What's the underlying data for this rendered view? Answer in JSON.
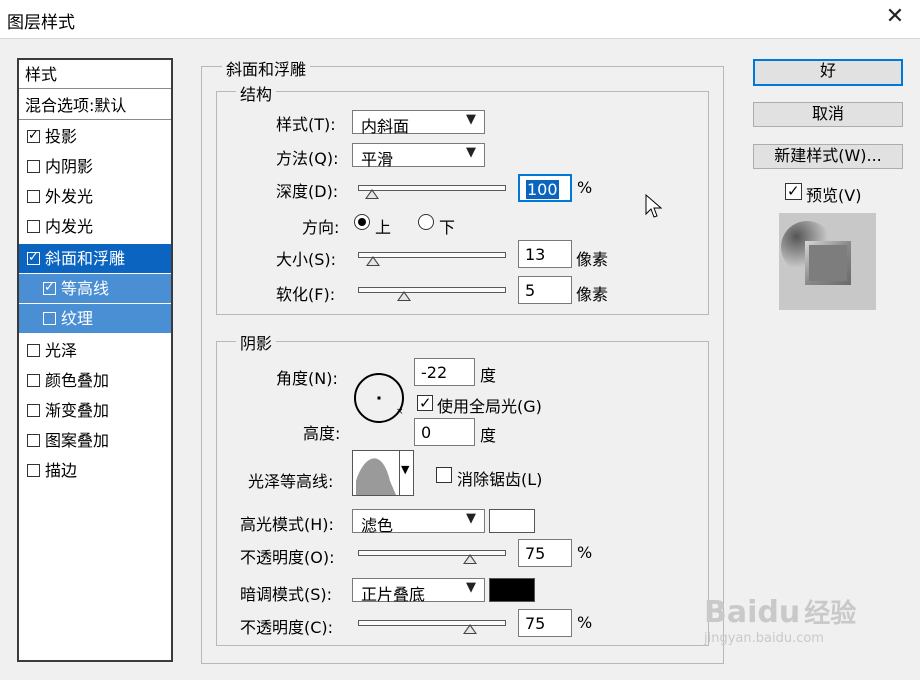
{
  "window": {
    "title": "图层样式",
    "close_icon": "close-icon"
  },
  "sidebar": {
    "header": "样式",
    "blend": "混合选项:默认",
    "items": [
      {
        "label": "投影",
        "checked": true
      },
      {
        "label": "内阴影",
        "checked": false
      },
      {
        "label": "外发光",
        "checked": false
      },
      {
        "label": "内发光",
        "checked": false
      },
      {
        "label": "斜面和浮雕",
        "checked": true,
        "selected": true
      },
      {
        "label": "等高线",
        "checked": true,
        "sub": true
      },
      {
        "label": "纹理",
        "checked": false,
        "sub": true
      },
      {
        "label": "光泽",
        "checked": false
      },
      {
        "label": "颜色叠加",
        "checked": false
      },
      {
        "label": "渐变叠加",
        "checked": false
      },
      {
        "label": "图案叠加",
        "checked": false
      },
      {
        "label": "描边",
        "checked": false
      }
    ]
  },
  "bevel": {
    "title": "斜面和浮雕",
    "structure": {
      "title": "结构",
      "style_label": "样式(T):",
      "style_value": "内斜面",
      "technique_label": "方法(Q):",
      "technique_value": "平滑",
      "depth_label": "深度(D):",
      "depth_value": "100",
      "depth_unit": "%",
      "direction_label": "方向:",
      "direction_up": "上",
      "direction_down": "下",
      "size_label": "大小(S):",
      "size_value": "13",
      "size_unit": "像素",
      "soften_label": "软化(F):",
      "soften_value": "5",
      "soften_unit": "像素"
    },
    "shading": {
      "title": "阴影",
      "angle_label": "角度(N):",
      "angle_value": "-22",
      "angle_unit": "度",
      "global_light_label": "使用全局光(G)",
      "global_light_checked": true,
      "altitude_label": "高度:",
      "altitude_value": "0",
      "altitude_unit": "度",
      "gloss_label": "光泽等高线:",
      "antialias_label": "消除锯齿(L)",
      "antialias_checked": false,
      "highlight_mode_label": "高光模式(H):",
      "highlight_mode_value": "滤色",
      "highlight_color": "#ffffff",
      "highlight_opacity_label": "不透明度(O):",
      "highlight_opacity_value": "75",
      "highlight_opacity_unit": "%",
      "shadow_mode_label": "暗调模式(S):",
      "shadow_mode_value": "正片叠底",
      "shadow_color": "#000000",
      "shadow_opacity_label": "不透明度(C):",
      "shadow_opacity_value": "75",
      "shadow_opacity_unit": "%"
    }
  },
  "buttons": {
    "ok": "好",
    "cancel": "取消",
    "new_style": "新建样式(W)..."
  },
  "preview": {
    "label": "预览(V)",
    "checked": true
  },
  "watermark": {
    "brand": "Baidu",
    "brand_cn": "经验",
    "url": "jingyan.baidu.com"
  }
}
